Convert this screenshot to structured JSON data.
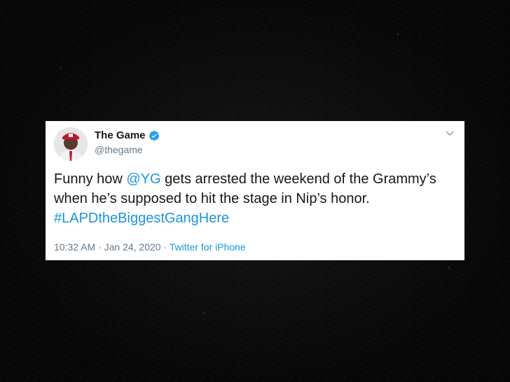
{
  "tweet": {
    "display_name": "The Game",
    "handle": "@thegame",
    "text_part1": "Funny how ",
    "mention": "@YG",
    "text_part2": " gets arrested the weekend of the Grammy’s when he’s supposed to hit the stage in Nip’s honor. ",
    "hashtag": "#LAPDtheBiggestGangHere",
    "time": "10:32 AM",
    "separator": " · ",
    "date": "Jan 24, 2020",
    "source": "Twitter for iPhone"
  },
  "icons": {
    "verified": "verified-badge-icon",
    "menu": "chevron-down-icon"
  },
  "colors": {
    "link": "#1b95e0",
    "muted": "#657786",
    "text": "#14171a",
    "verified": "#1da1f2",
    "background": "#0a0a0a"
  }
}
